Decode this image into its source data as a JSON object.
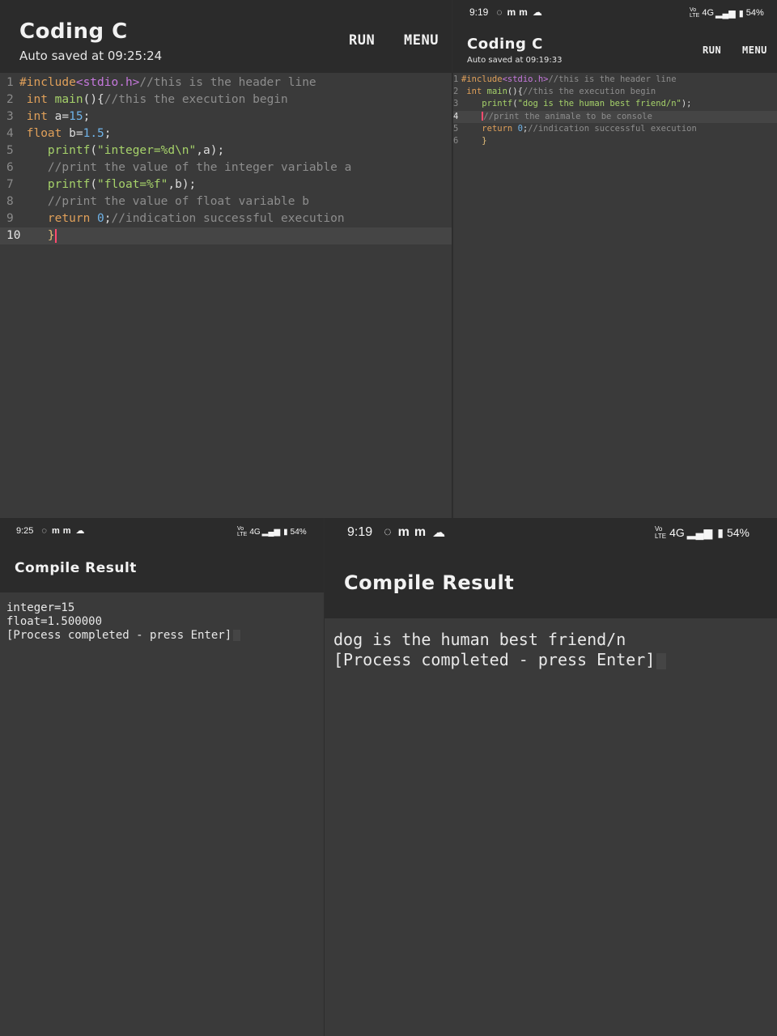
{
  "editor_large": {
    "title": "Coding C",
    "autosave": "Auto saved at 09:25:24",
    "run_label": "RUN",
    "menu_label": "MENU",
    "lines": [
      {
        "num": "1",
        "tokens": [
          [
            "pp",
            "#include"
          ],
          [
            "inc",
            "<stdio.h>"
          ],
          [
            "cm",
            "//this is the header line"
          ]
        ]
      },
      {
        "num": "2",
        "tokens": [
          [
            "pl",
            " "
          ],
          [
            "kw",
            "int"
          ],
          [
            "pl",
            " "
          ],
          [
            "fn",
            "main"
          ],
          [
            "pl",
            "(){"
          ],
          [
            "cm",
            "//this the execution begin"
          ]
        ]
      },
      {
        "num": "3",
        "tokens": [
          [
            "pl",
            " "
          ],
          [
            "kw",
            "int"
          ],
          [
            "pl",
            " a="
          ],
          [
            "num",
            "15"
          ],
          [
            "pl",
            ";"
          ]
        ]
      },
      {
        "num": "4",
        "tokens": [
          [
            "pl",
            " "
          ],
          [
            "kw",
            "float"
          ],
          [
            "pl",
            " b="
          ],
          [
            "num",
            "1.5"
          ],
          [
            "pl",
            ";"
          ]
        ]
      },
      {
        "num": "5",
        "tokens": [
          [
            "pl",
            "    "
          ],
          [
            "fn",
            "printf"
          ],
          [
            "pl",
            "("
          ],
          [
            "str",
            "\"integer=%d\\n\""
          ],
          [
            "pl",
            ",a);"
          ]
        ]
      },
      {
        "num": "6",
        "tokens": [
          [
            "pl",
            "    "
          ],
          [
            "cm",
            "//print the value of the integer variable a"
          ]
        ]
      },
      {
        "num": "7",
        "tokens": [
          [
            "pl",
            "    "
          ],
          [
            "fn",
            "printf"
          ],
          [
            "pl",
            "("
          ],
          [
            "str",
            "\"float=%f\""
          ],
          [
            "pl",
            ",b);"
          ]
        ]
      },
      {
        "num": "8",
        "tokens": [
          [
            "pl",
            "    "
          ],
          [
            "cm",
            "//print the value of float variable b"
          ]
        ]
      },
      {
        "num": "9",
        "tokens": [
          [
            "pl",
            "    "
          ],
          [
            "kw",
            "return"
          ],
          [
            "pl",
            " "
          ],
          [
            "num",
            "0"
          ],
          [
            "pl",
            ";"
          ],
          [
            "cm",
            "//indication successful execution"
          ]
        ]
      },
      {
        "num": "10",
        "tokens": [
          [
            "pl",
            "    "
          ],
          [
            "br",
            "}"
          ]
        ]
      }
    ]
  },
  "editor_small": {
    "status_time": "9:19",
    "status_icons": [
      "whatsapp-icon",
      "gmail-icon",
      "gmail-icon",
      "cloud-icon"
    ],
    "status_network": "4G",
    "status_battery": "54%",
    "title": "Coding C",
    "autosave": "Auto saved at 09:19:33",
    "run_label": "RUN",
    "menu_label": "MENU",
    "lines": [
      {
        "num": "1",
        "tokens": [
          [
            "pp",
            "#include"
          ],
          [
            "inc",
            "<stdio.h>"
          ],
          [
            "cm",
            "//this is the header line"
          ]
        ]
      },
      {
        "num": "2",
        "tokens": [
          [
            "pl",
            " "
          ],
          [
            "kw",
            "int"
          ],
          [
            "pl",
            " "
          ],
          [
            "fn",
            "main"
          ],
          [
            "pl",
            "(){"
          ],
          [
            "cm",
            "//this the execution begin"
          ]
        ]
      },
      {
        "num": "3",
        "tokens": [
          [
            "pl",
            "    "
          ],
          [
            "fn",
            "printf"
          ],
          [
            "pl",
            "("
          ],
          [
            "str",
            "\"dog is the human best friend/n\""
          ],
          [
            "pl",
            ");"
          ]
        ]
      },
      {
        "num": "4",
        "tokens": [
          [
            "pl",
            "    "
          ],
          [
            "cm",
            "//print the animale to be console"
          ]
        ]
      },
      {
        "num": "5",
        "tokens": [
          [
            "pl",
            "    "
          ],
          [
            "kw",
            "return"
          ],
          [
            "pl",
            " "
          ],
          [
            "num",
            "0"
          ],
          [
            "pl",
            ";"
          ],
          [
            "cm",
            "//indication successful execution"
          ]
        ]
      },
      {
        "num": "6",
        "tokens": [
          [
            "pl",
            "    "
          ],
          [
            "br",
            "}"
          ]
        ]
      }
    ]
  },
  "result_small": {
    "status_time": "9:25",
    "status_network": "4G",
    "status_battery": "54%",
    "title": "Compile Result",
    "output": [
      "integer=15",
      "float=1.500000",
      "[Process completed - press Enter]"
    ]
  },
  "result_large": {
    "status_time": "9:19",
    "status_network": "4G",
    "status_battery": "54%",
    "title": "Compile Result",
    "output": [
      "dog is the human best friend/n",
      "[Process completed - press Enter]"
    ]
  }
}
